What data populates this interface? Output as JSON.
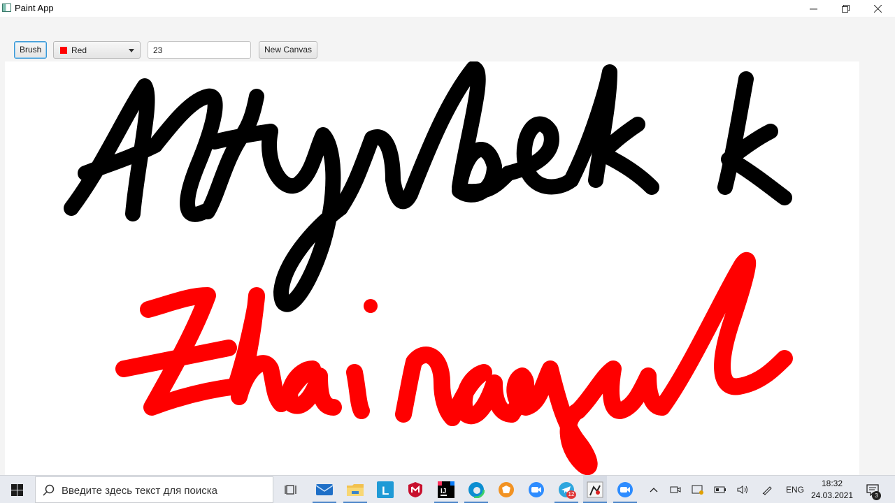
{
  "window": {
    "title": "Paint App",
    "controls": [
      "minimize",
      "restore",
      "close"
    ]
  },
  "toolbar": {
    "brush_label": "Brush",
    "color": {
      "selected": "Red",
      "swatch": "#ff0000"
    },
    "size_value": "23",
    "new_canvas_label": "New Canvas"
  },
  "canvas": {
    "background": "#ffffff",
    "strokes": [
      {
        "color": "#000000",
        "text": "Altynbek k"
      },
      {
        "color": "#ff0000",
        "text": "Zhainagul"
      }
    ]
  },
  "taskbar": {
    "search_placeholder": "Введите здесь текст для поиска",
    "pinned_icons": [
      "task-view-icon",
      "mail-icon",
      "file-explorer-icon",
      "l-app-icon",
      "mcafee-icon",
      "intellij-icon",
      "edge-icon",
      "browser-icon",
      "zoom-icon",
      "telegram-icon",
      "paint-app-icon",
      "zoom-active-icon"
    ],
    "telegram_badge": "12",
    "language": "ENG",
    "time": "18:32",
    "date": "24.03.2021",
    "notifications": "3"
  }
}
